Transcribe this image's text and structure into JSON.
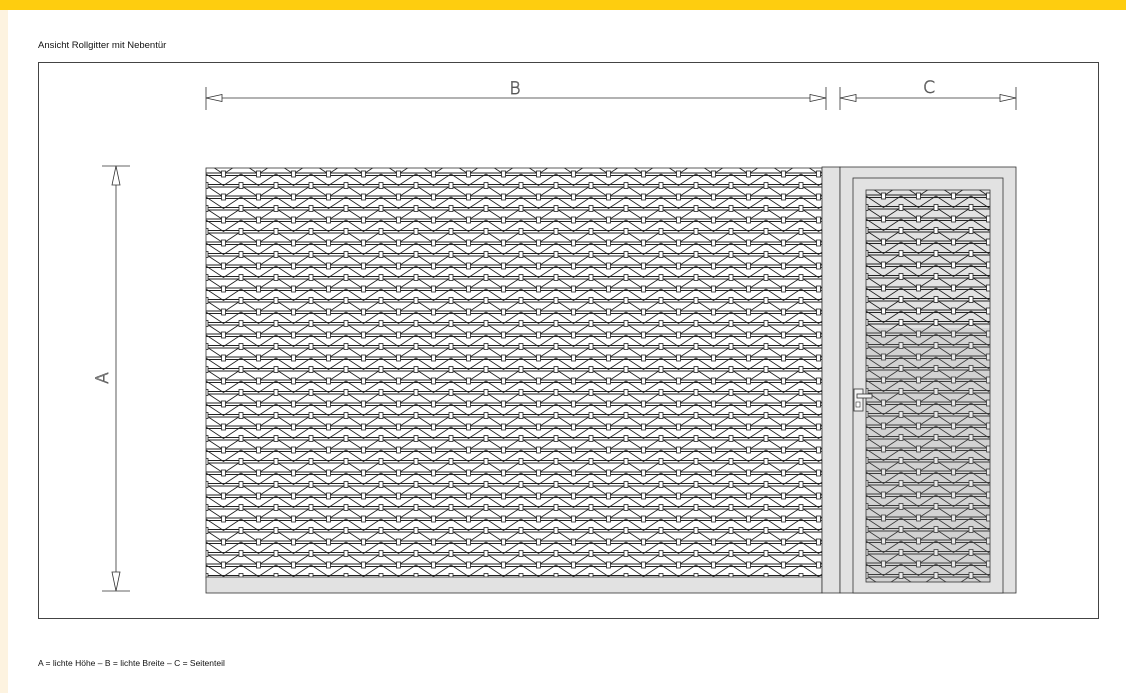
{
  "title": "Ansicht Rollgitter mit Nebentür",
  "legend": "A = lichte Höhe – B = lichte Breite – C = Seitenteil",
  "dimensions": {
    "a_label": "A",
    "b_label": "B",
    "c_label": "C"
  },
  "colors": {
    "accent_bar": "#fecd0f",
    "side_strip": "#fdf3e0",
    "frame_fill": "#e2e2e2",
    "lower_shading": "#e4e4e4"
  }
}
